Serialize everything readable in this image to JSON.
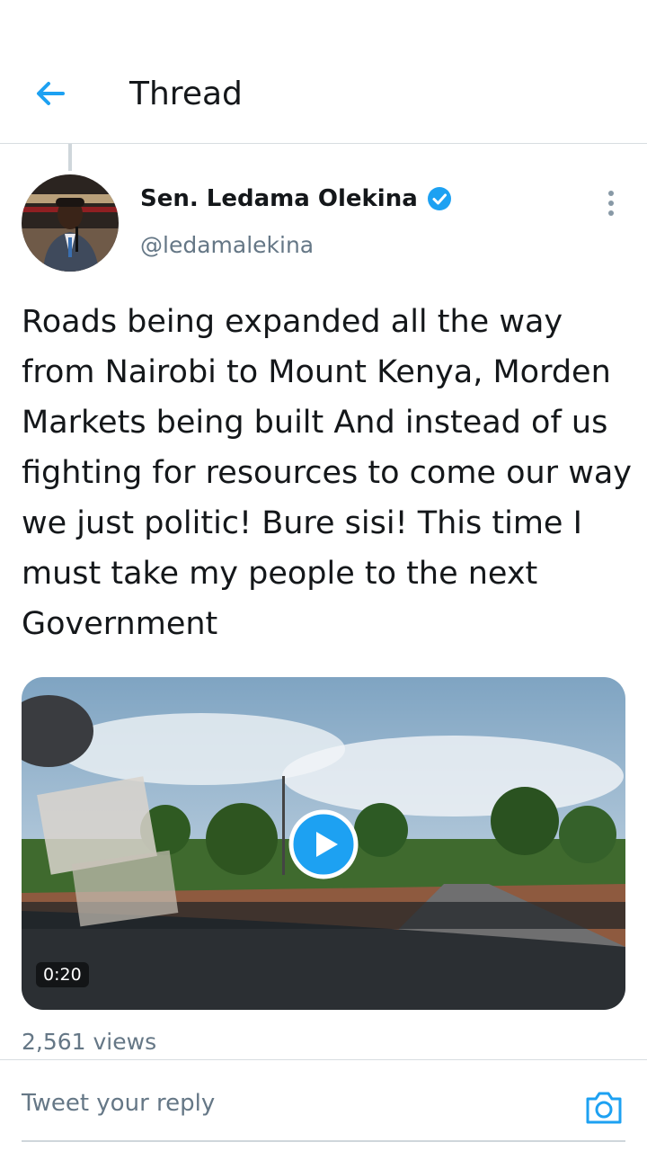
{
  "header": {
    "title": "Thread"
  },
  "tweet": {
    "author_name": "Sen. Ledama Olekina",
    "handle": "@ledamalekina",
    "text": "Roads being expanded all the way from Nairobi to Mount Kenya, Morden Markets being built And instead of us fighting for resources to come our way we just politic! Bure sisi! This time I must take my people to the next Government",
    "video_duration": "0:20",
    "views": "2,561 views"
  },
  "reply": {
    "placeholder": "Tweet your reply"
  },
  "colors": {
    "accent": "#1da1f2",
    "secondary_text": "#657786",
    "divider": "#d8dde1"
  },
  "icons": [
    "back-arrow-icon",
    "verified-badge-icon",
    "more-options-icon",
    "play-icon",
    "camera-icon"
  ]
}
